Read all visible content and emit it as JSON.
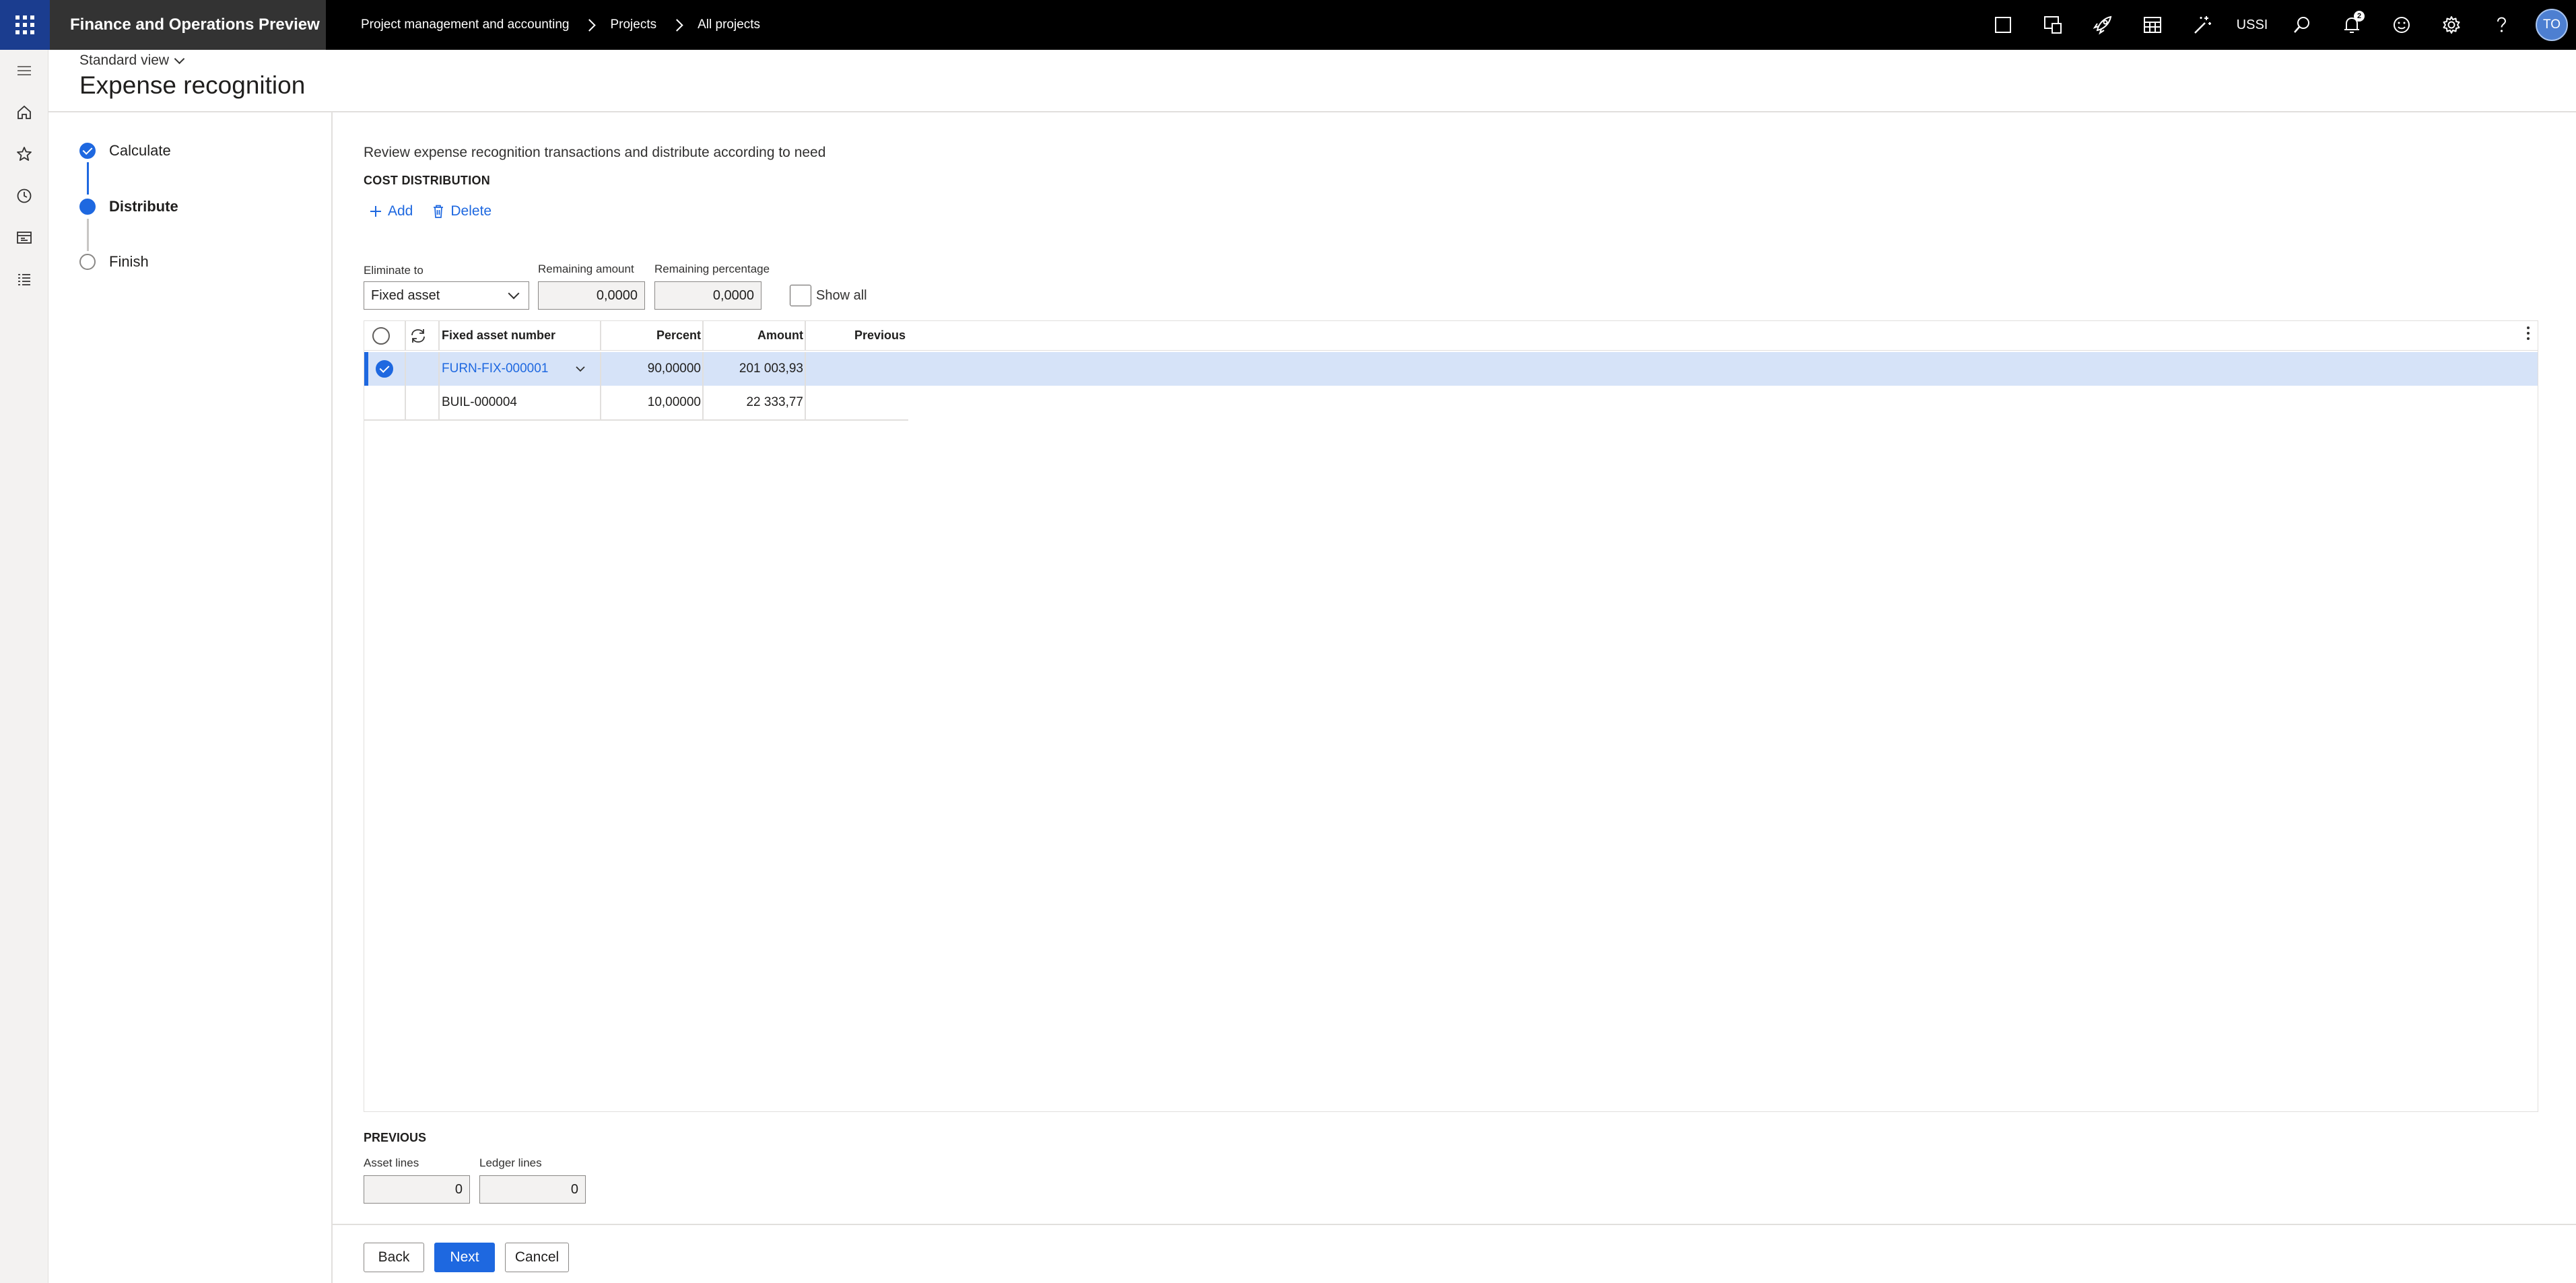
{
  "app": {
    "title": "Finance and Operations Preview",
    "breadcrumbs": [
      "Project management and accounting",
      "Projects",
      "All projects"
    ],
    "company": "USSI",
    "notification_count": "2",
    "user_initials": "TO"
  },
  "header": {
    "view": "Standard view",
    "title": "Expense recognition"
  },
  "steps": [
    {
      "label": "Calculate",
      "state": "done"
    },
    {
      "label": "Distribute",
      "state": "current"
    },
    {
      "label": "Finish",
      "state": "todo"
    }
  ],
  "main": {
    "description": "Review expense recognition transactions and distribute according to need",
    "section_title": "COST DISTRIBUTION",
    "add_label": "Add",
    "delete_label": "Delete"
  },
  "fields": {
    "eliminate_to_label": "Eliminate to",
    "eliminate_to_value": "Fixed asset",
    "remaining_amount_label": "Remaining amount",
    "remaining_amount_value": "0,0000",
    "remaining_percentage_label": "Remaining percentage",
    "remaining_percentage_value": "0,0000",
    "show_all_label": "Show all"
  },
  "grid": {
    "columns": [
      "Fixed asset number",
      "Percent",
      "Amount",
      "Previous"
    ],
    "rows": [
      {
        "asset": "FURN-FIX-000001",
        "percent": "90,00000",
        "amount": "201 003,93",
        "previous": "",
        "selected": true
      },
      {
        "asset": "BUIL-000004",
        "percent": "10,00000",
        "amount": "22 333,77",
        "previous": "",
        "selected": false
      }
    ]
  },
  "previous": {
    "section_title": "PREVIOUS",
    "asset_lines_label": "Asset lines",
    "asset_lines_value": "0",
    "ledger_lines_label": "Ledger lines",
    "ledger_lines_value": "0"
  },
  "footer": {
    "back": "Back",
    "next": "Next",
    "cancel": "Cancel"
  },
  "colors": {
    "accent": "#1e68e0",
    "selected_row": "#d6e3f8",
    "topbar": "#000000",
    "app_title_bg": "#333333"
  }
}
